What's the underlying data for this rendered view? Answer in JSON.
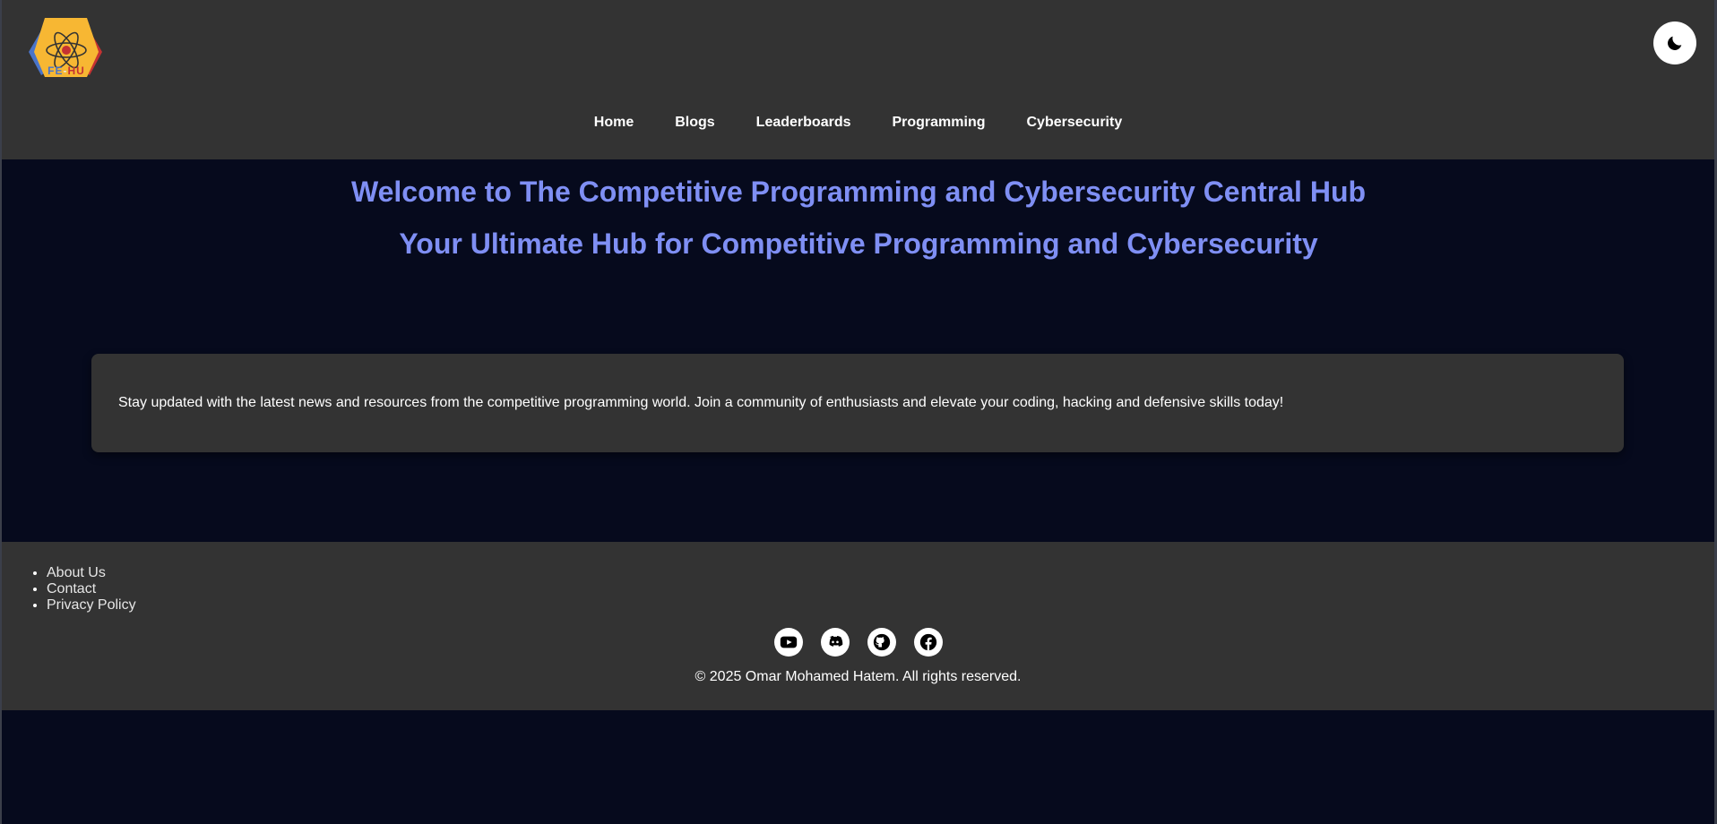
{
  "header": {
    "logo": {
      "text_fe": "FE",
      "text_dash": "-",
      "text_hu": "HU"
    },
    "theme_toggle_icon": "moon-icon",
    "nav": [
      {
        "label": "Home"
      },
      {
        "label": "Blogs"
      },
      {
        "label": "Leaderboards"
      },
      {
        "label": "Programming"
      },
      {
        "label": "Cybersecurity"
      }
    ]
  },
  "hero": {
    "title": "Welcome to The Competitive Programming and Cybersecurity Central Hub",
    "subtitle": "Your Ultimate Hub for Competitive Programming and Cybersecurity"
  },
  "info_card": {
    "text": "Stay updated with the latest news and resources from the competitive programming world. Join a community of enthusiasts and elevate your coding, hacking and defensive skills today!"
  },
  "footer": {
    "links": [
      {
        "label": "About Us"
      },
      {
        "label": "Contact"
      },
      {
        "label": "Privacy Policy"
      }
    ],
    "social_icons": [
      "youtube-icon",
      "discord-icon",
      "github-icon",
      "facebook-icon"
    ],
    "copyright": "© 2025 Omar Mohamed Hatem. All rights reserved."
  },
  "colors": {
    "page_background": "#060a1d",
    "panel_background": "#333333",
    "heading_accent": "#7f8ff4",
    "logo_blue": "#4a74c9",
    "logo_yellow": "#f7b733",
    "logo_red": "#c53232"
  }
}
